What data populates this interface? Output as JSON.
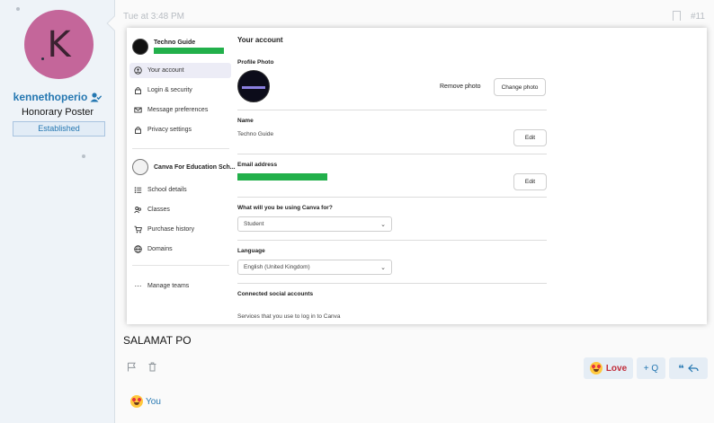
{
  "user": {
    "avatar_letter": "K",
    "username": "kennethoperio",
    "title": "Honorary Poster",
    "badge": "Established"
  },
  "post": {
    "time": "Tue at 3:48 PM",
    "number": "#11",
    "message": "SALAMAT PO",
    "actions": {
      "love_label": "Love",
      "quote_label": "+ Q"
    },
    "reactions_by": "You"
  },
  "screenshot": {
    "nav": {
      "team_name": "Techno Guide",
      "items": [
        {
          "label": "Your account",
          "icon": "user-circle-icon"
        },
        {
          "label": "Login & security",
          "icon": "lock-icon"
        },
        {
          "label": "Message preferences",
          "icon": "mail-icon"
        },
        {
          "label": "Privacy settings",
          "icon": "lock-icon"
        }
      ],
      "school_name": "Canva For Education Sch...",
      "school_items": [
        {
          "label": "School details",
          "icon": "list-icon"
        },
        {
          "label": "Classes",
          "icon": "people-icon"
        },
        {
          "label": "Purchase history",
          "icon": "cart-icon"
        },
        {
          "label": "Domains",
          "icon": "globe-icon"
        }
      ],
      "manage_label": "Manage teams"
    },
    "main": {
      "heading": "Your account",
      "profile_photo_label": "Profile Photo",
      "remove_photo": "Remove photo",
      "change_photo": "Change photo",
      "name_label": "Name",
      "name_value": "Techno Guide",
      "edit_label": "Edit",
      "email_label": "Email address",
      "usage_label": "What will you be using Canva for?",
      "usage_value": "Student",
      "language_label": "Language",
      "language_value": "English (United Kingdom)",
      "social_label": "Connected social accounts",
      "social_text": "Services that you use to log in to Canva"
    }
  },
  "colors": {
    "accent": "#2577b1",
    "love": "#c12d3a",
    "redaction_green": "#22b04b",
    "avatar_bg": "#c4669a"
  }
}
